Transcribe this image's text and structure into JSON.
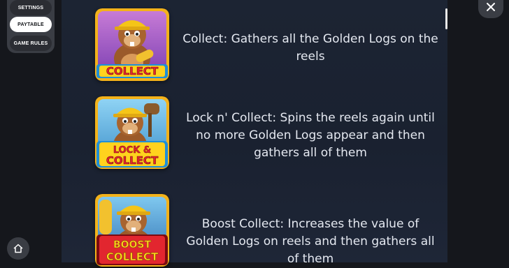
{
  "sidebar": {
    "items": [
      {
        "label": "SETTINGS",
        "active": false
      },
      {
        "label": "PAYTABLE",
        "active": true
      },
      {
        "label": "GAME RULES",
        "active": false
      }
    ]
  },
  "nav": {
    "home_icon": "home-icon",
    "close_icon": "close-icon"
  },
  "features": [
    {
      "badge": "COLLECT",
      "icon": "beaver-collect-symbol",
      "text": "Collect: Gathers all the Golden Logs on the reels"
    },
    {
      "badge_line1": "LOCK &",
      "badge_line2": "COLLECT",
      "icon": "beaver-lock-collect-symbol",
      "text": "Lock n' Collect: Spins the reels again until no more Golden Logs appear and then gathers all of them"
    },
    {
      "badge_line1": "BOOST",
      "badge_line2": "COLLECT",
      "icon": "beaver-boost-collect-symbol",
      "text": "Boost Collect: Increases the value of Golden Logs on reels and then gathers all of them"
    }
  ],
  "colors": {
    "background": "#15171c",
    "panel": "#1c2433",
    "sidebar": "#3a3d44",
    "text": "#e4e8f0",
    "badge_red": "#e2262f",
    "badge_yellow": "#ffd21e",
    "badge_blue": "#1e8fd8"
  }
}
